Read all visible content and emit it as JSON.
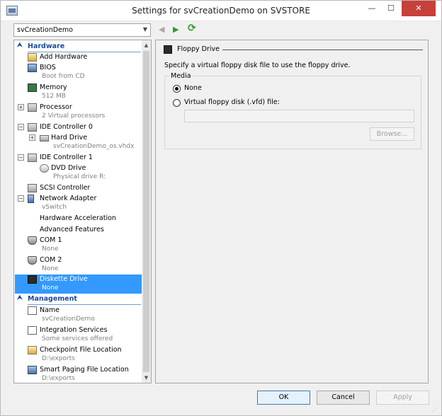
{
  "window": {
    "title": "Settings for svCreationDemo on SVSTORE",
    "minimize": "—",
    "maximize": "☐",
    "close": "✕"
  },
  "toolbar": {
    "vm_select_value": "svCreationDemo",
    "back": "◀",
    "forward": "▶",
    "refresh": "⟳"
  },
  "sidebar": {
    "hardware_header": "Hardware",
    "management_header": "Management",
    "items": {
      "add_hardware": {
        "label": "Add Hardware"
      },
      "bios": {
        "label": "BIOS",
        "sub": "Boot from CD"
      },
      "memory": {
        "label": "Memory",
        "sub": "512 MB"
      },
      "processor": {
        "label": "Processor",
        "sub": "2 Virtual processors"
      },
      "ide0": {
        "label": "IDE Controller 0"
      },
      "hard_drive": {
        "label": "Hard Drive",
        "sub": "svCreationDemo_os.vhdx"
      },
      "ide1": {
        "label": "IDE Controller 1"
      },
      "dvd_drive": {
        "label": "DVD Drive",
        "sub": "Physical drive R:"
      },
      "scsi": {
        "label": "SCSI Controller"
      },
      "network": {
        "label": "Network Adapter",
        "sub": "vSwitch"
      },
      "hw_accel": {
        "label": "Hardware Acceleration"
      },
      "adv_features": {
        "label": "Advanced Features"
      },
      "com1": {
        "label": "COM 1",
        "sub": "None"
      },
      "com2": {
        "label": "COM 2",
        "sub": "None"
      },
      "diskette": {
        "label": "Diskette Drive",
        "sub": "None"
      },
      "name": {
        "label": "Name",
        "sub": "svCreationDemo"
      },
      "integration": {
        "label": "Integration Services",
        "sub": "Some services offered"
      },
      "checkpoint": {
        "label": "Checkpoint File Location",
        "sub": "D:\\exports"
      },
      "smart_paging": {
        "label": "Smart Paging File Location",
        "sub": "D:\\exports"
      }
    }
  },
  "content": {
    "header": "Floppy Drive",
    "description": "Specify a virtual floppy disk file to use the floppy drive.",
    "media_label": "Media",
    "option_none": "None",
    "option_vfd": "Virtual floppy disk (.vfd) file:",
    "vfd_path": "",
    "browse": "Browse..."
  },
  "footer": {
    "ok": "OK",
    "cancel": "Cancel",
    "apply": "Apply"
  },
  "colors": {
    "selection": "#3399ff",
    "header_blue": "#1a4a9c"
  }
}
